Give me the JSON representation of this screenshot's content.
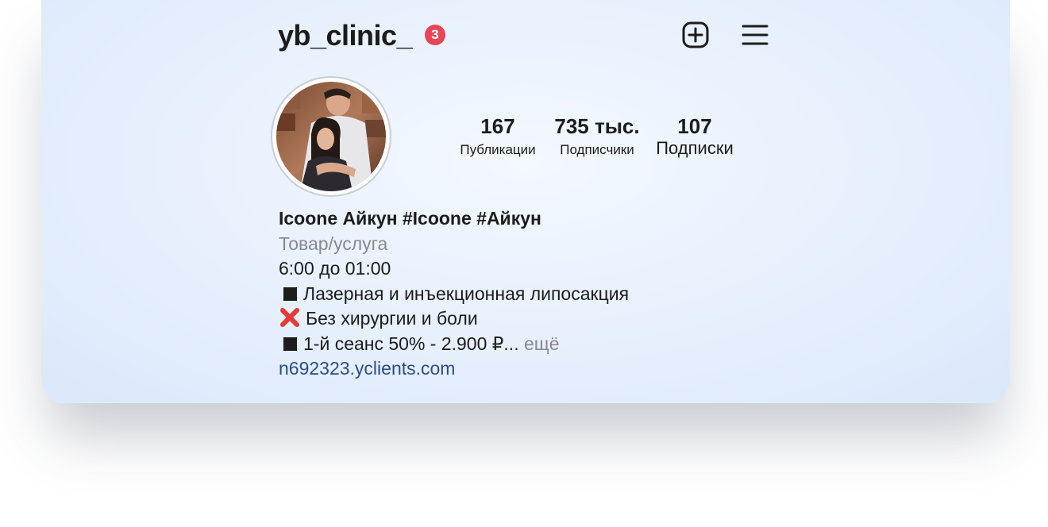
{
  "header": {
    "username": "yb_clinic_",
    "notification_count": "3",
    "icons": {
      "add": "plus-square-icon",
      "menu": "hamburger-menu-icon"
    }
  },
  "profile": {
    "avatar": "profile-photo",
    "stats": [
      {
        "value": "167",
        "label": "Публикации"
      },
      {
        "value": "735 тыс.",
        "label": "Подписчики"
      },
      {
        "value": "107",
        "label": "Подписки"
      }
    ]
  },
  "bio": {
    "name": "Icoone Айкун  #Icoone  #Айкун",
    "category": "Товар/услуга",
    "hours": "6:00 до 01:00",
    "line1": "Лазерная и инъекционная липосакция",
    "line2": "Без хирургии и боли",
    "line3": "1-й сеанс 50% - 2.900 ₽...",
    "more": "ещё",
    "link": "n692323.yclients.com"
  },
  "colors": {
    "badge": "#e8445a",
    "link": "#2b4e86",
    "muted": "#8a8a8e",
    "cross": "#e53935"
  }
}
